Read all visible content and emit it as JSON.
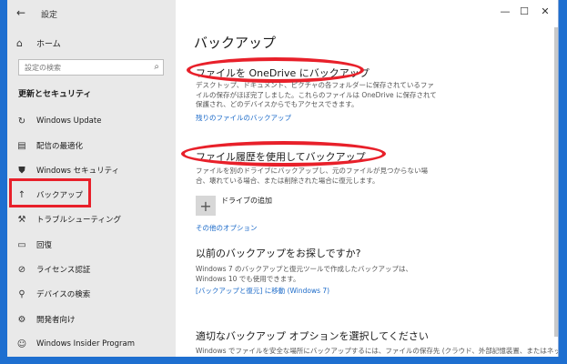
{
  "window": {
    "back_icon": "←",
    "title": "設定",
    "minimize": "—",
    "maximize": "☐",
    "close": "✕"
  },
  "sidebar": {
    "home_label": "ホーム",
    "search_placeholder": "設定の検索",
    "section_title": "更新とセキュリティ",
    "items": [
      {
        "label": "Windows Update",
        "icon": "refresh-icon"
      },
      {
        "label": "配信の最適化",
        "icon": "delivery-icon"
      },
      {
        "label": "Windows セキュリティ",
        "icon": "shield-icon"
      },
      {
        "label": "バックアップ",
        "icon": "backup-arrow-icon"
      },
      {
        "label": "トラブルシューティング",
        "icon": "wrench-icon"
      },
      {
        "label": "回復",
        "icon": "recovery-icon"
      },
      {
        "label": "ライセンス認証",
        "icon": "check-circle-icon"
      },
      {
        "label": "デバイスの検索",
        "icon": "find-device-icon"
      },
      {
        "label": "開発者向け",
        "icon": "developer-icon"
      },
      {
        "label": "Windows Insider Program",
        "icon": "insider-icon"
      }
    ]
  },
  "main": {
    "page_title": "バックアップ",
    "onedrive": {
      "heading": "ファイルを OneDrive にバックアップ",
      "description": "デスクトップ、ドキュメント、ピクチャの各フォルダーに保存されているファイルの保存がほぼ完了しました。これらのファイルは OneDrive に保存されて保護され、どのデバイスからでもアクセスできます。",
      "link": "残りのファイルのバックアップ"
    },
    "file_history": {
      "heading": "ファイル履歴を使用してバックアップ",
      "description": "ファイルを別のドライブにバックアップし、元のファイルが見つからない場合、壊れている場合、または削除された場合に復元します。",
      "add_drive": "ドライブの追加",
      "more_options": "その他のオプション"
    },
    "older_backup": {
      "heading": "以前のバックアップをお探しですか?",
      "description": "Windows 7 のバックアップと復元ツールで作成したバックアップは、Windows 10 でも使用できます。",
      "link": "[バックアップと復元] に移動 (Windows 7)"
    },
    "choose_option": {
      "heading": "適切なバックアップ オプションを選択してください",
      "description": "Windows でファイルを安全な場所にバックアップするには、ファイルの保存先 (クラウド、外部記憶装置、またはネットワー"
    }
  },
  "colors": {
    "accent_link": "#1b6ac9",
    "annotation_red": "#e8202a",
    "desktop_blue": "#1e6fd0"
  }
}
